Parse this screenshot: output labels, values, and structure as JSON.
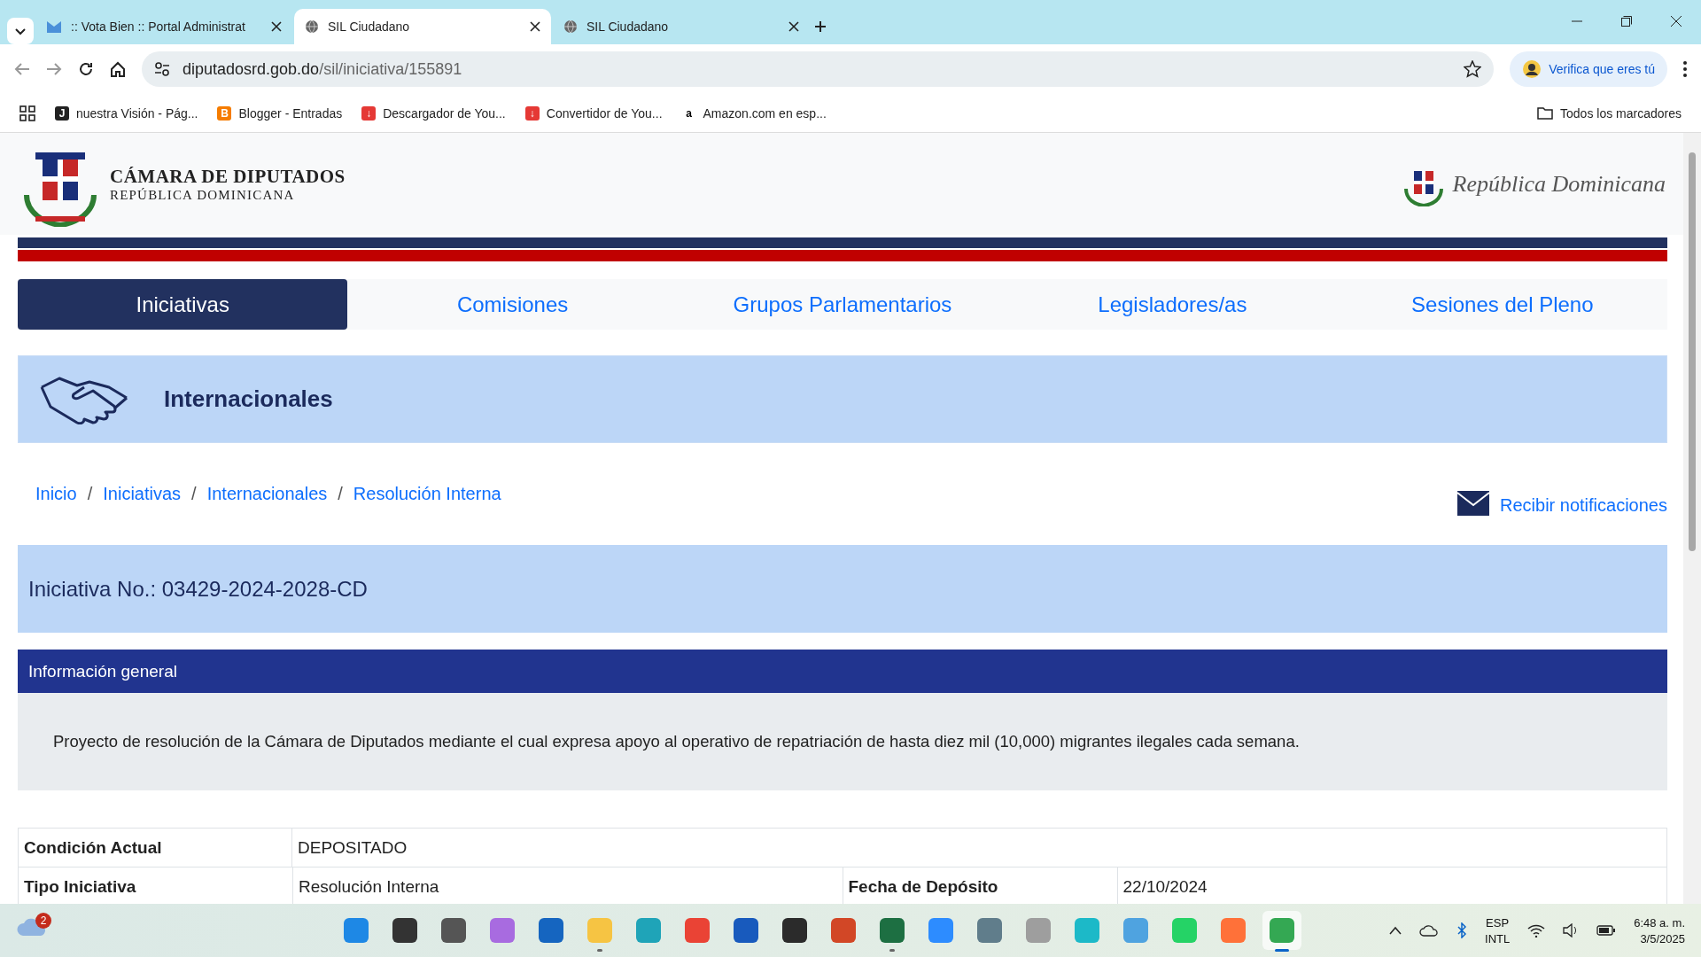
{
  "browser": {
    "tabs": [
      {
        "title": ":: Vota Bien :: Portal Administrat",
        "selected": false
      },
      {
        "title": "SIL Ciudadano",
        "selected": true
      },
      {
        "title": "SIL Ciudadano",
        "selected": false
      }
    ],
    "address": {
      "domain": "diputadosrd.gob.do",
      "path": "/sil/iniciativa/155891"
    },
    "profile_button": "Verifica que eres tú",
    "bookmarks": [
      {
        "label": "nuestra Visión - Pág...",
        "color": "#222222",
        "glyph": "J"
      },
      {
        "label": "Blogger - Entradas",
        "color": "#f57c00",
        "glyph": "B"
      },
      {
        "label": "Descargador de You...",
        "color": "#e53935",
        "glyph": "↓"
      },
      {
        "label": "Convertidor de You...",
        "color": "#e53935",
        "glyph": "↓"
      },
      {
        "label": "Amazon.com en esp...",
        "color": "#ffffff",
        "glyph": "a"
      }
    ],
    "all_bookmarks": "Todos los marcadores"
  },
  "page": {
    "header": {
      "title": "CÁMARA DE DIPUTADOS",
      "subtitle": "REPÚBLICA DOMINICANA",
      "right_logo": "República Dominicana"
    },
    "nav": [
      {
        "label": "Iniciativas",
        "selected": true
      },
      {
        "label": "Comisiones",
        "selected": false
      },
      {
        "label": "Grupos Parlamentarios",
        "selected": false
      },
      {
        "label": "Legisladores/as",
        "selected": false
      },
      {
        "label": "Sesiones del Pleno",
        "selected": false
      }
    ],
    "section_title": "Internacionales",
    "breadcrumb": [
      {
        "label": "Inicio",
        "separator": "/"
      },
      {
        "label": "Iniciativas",
        "separator": "/"
      },
      {
        "label": "Internacionales",
        "separator": "/"
      },
      {
        "label": "Resolución Interna"
      }
    ],
    "notify_link": "Recibir notificaciones",
    "initiative_number": "Iniciativa No.: 03429-2024-2028-CD",
    "info_header": "Información general",
    "description": "Proyecto de resolución de la Cámara de Diputados mediante el cual expresa apoyo al operativo de repatriación de hasta diez mil (10,000) migrantes ilegales cada semana.",
    "status": {
      "label": "Condición Actual",
      "value": "DEPOSITADO"
    },
    "table": {
      "rows": [
        {
          "cells": [
            {
              "kind": "label",
              "text": "Tipo Iniciativa"
            },
            {
              "kind": "value",
              "text": "Resolución Interna"
            },
            {
              "kind": "label",
              "text": "Fecha de Depósito"
            },
            {
              "kind": "value",
              "text": "22/10/2024"
            }
          ]
        }
      ]
    }
  },
  "taskbar": {
    "weather_badge": "2",
    "apps": [
      {
        "color": "#1e88e5",
        "running": false,
        "selected": false
      },
      {
        "color": "#333333",
        "running": false,
        "selected": false
      },
      {
        "color": "#555555",
        "running": false,
        "selected": false
      },
      {
        "color": "#a86be0",
        "running": false,
        "selected": false
      },
      {
        "color": "#1565c0",
        "running": false,
        "selected": false
      },
      {
        "color": "#f6c443",
        "running": true,
        "selected": false
      },
      {
        "color": "#1fa4b8",
        "running": false,
        "selected": false
      },
      {
        "color": "#ea4335",
        "running": false,
        "selected": false
      },
      {
        "color": "#185abd",
        "running": false,
        "selected": false
      },
      {
        "color": "#2b2b2b",
        "running": false,
        "selected": false
      },
      {
        "color": "#d24726",
        "running": false,
        "selected": false
      },
      {
        "color": "#1d6f42",
        "running": true,
        "selected": false
      },
      {
        "color": "#2d8cff",
        "running": false,
        "selected": false
      },
      {
        "color": "#607d8b",
        "running": false,
        "selected": false
      },
      {
        "color": "#9e9e9e",
        "running": false,
        "selected": false
      },
      {
        "color": "#1cb9c8",
        "running": false,
        "selected": false
      },
      {
        "color": "#4fa3e0",
        "running": false,
        "selected": false
      },
      {
        "color": "#25d366",
        "running": false,
        "selected": false
      },
      {
        "color": "#ff7139",
        "running": false,
        "selected": false
      },
      {
        "color": "#34a853",
        "running": true,
        "selected": true
      }
    ],
    "language": "ESP",
    "layout": "INTL",
    "time": "6:48 a. m.",
    "date": "3/5/2025"
  }
}
